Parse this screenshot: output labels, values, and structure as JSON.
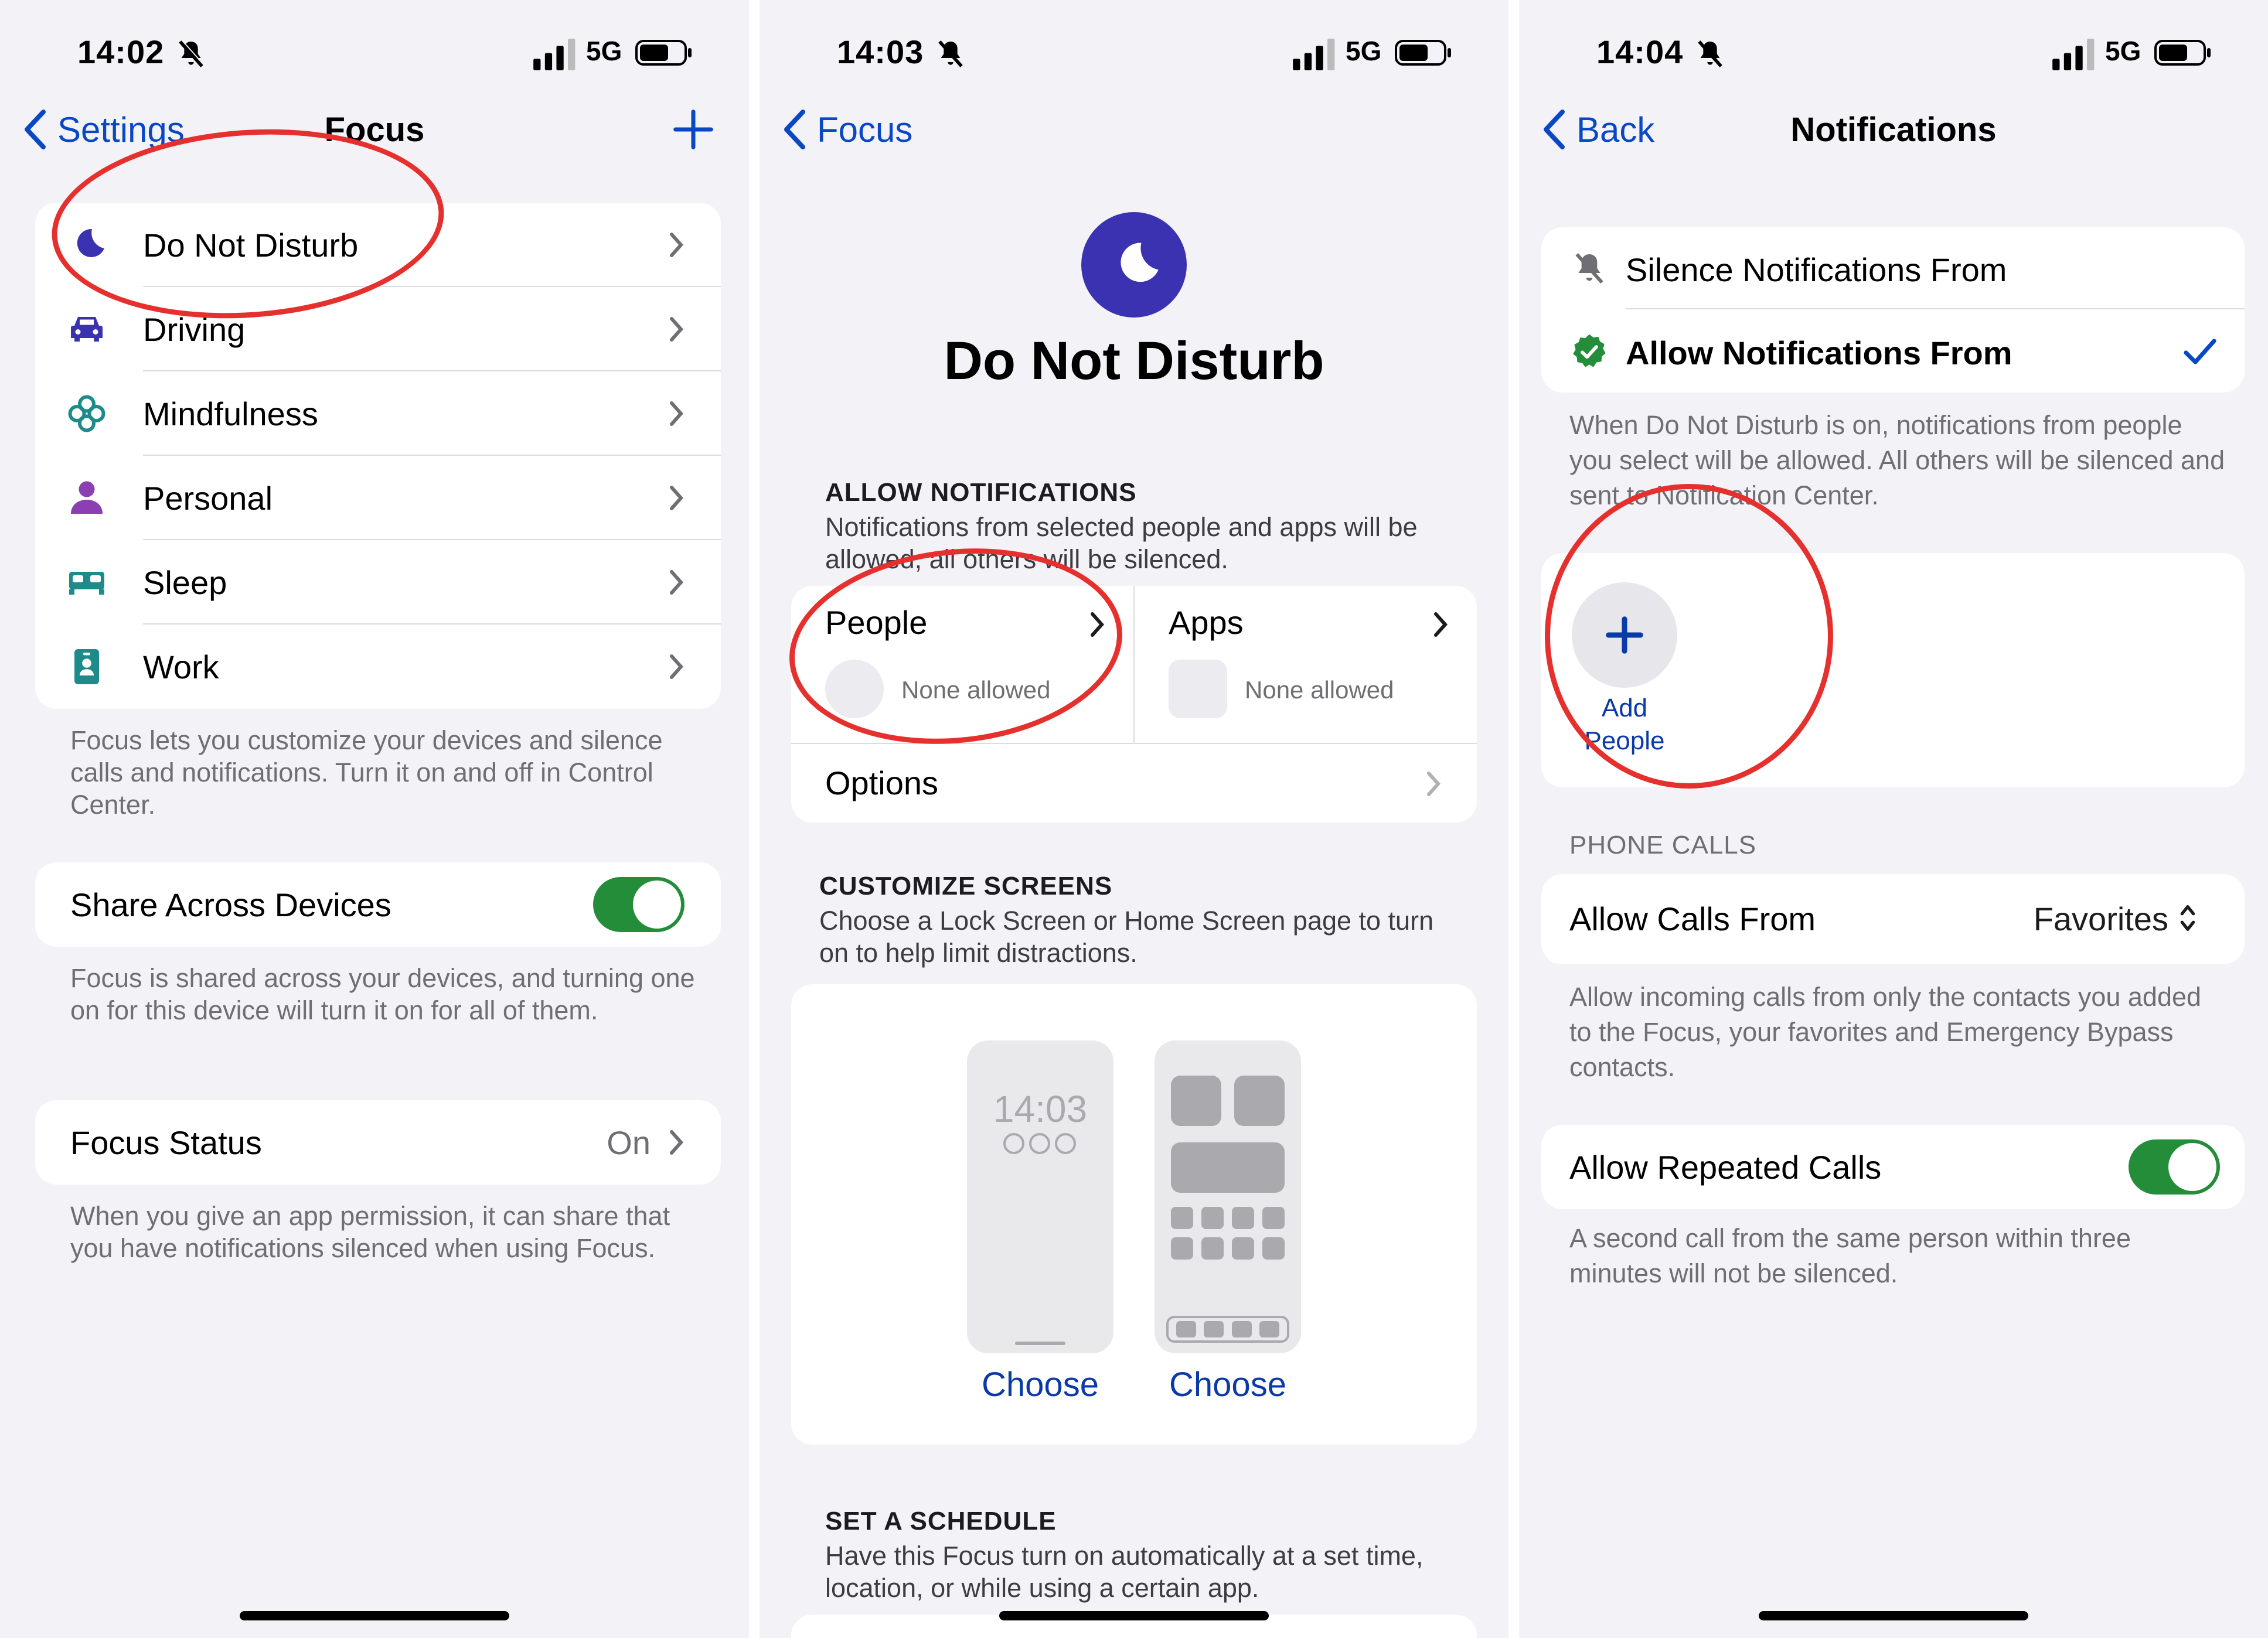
{
  "colors": {
    "accent": "#0a47c4",
    "toggle_on": "#238d3a",
    "annotation": "#e5302e",
    "dnd_purple": "#3a32b0"
  },
  "panel1": {
    "status": {
      "time": "14:02",
      "network": "5G"
    },
    "nav": {
      "back_label": "Settings",
      "title": "Focus"
    },
    "focus_list": [
      {
        "label": "Do Not Disturb",
        "icon": "moon-icon"
      },
      {
        "label": "Driving",
        "icon": "car-icon"
      },
      {
        "label": "Mindfulness",
        "icon": "flower-icon"
      },
      {
        "label": "Personal",
        "icon": "person-icon"
      },
      {
        "label": "Sleep",
        "icon": "bed-icon"
      },
      {
        "label": "Work",
        "icon": "badge-icon"
      }
    ],
    "focus_footer": "Focus lets you customize your devices and silence calls and notifications. Turn it on and off in Control Center.",
    "share_label": "Share Across Devices",
    "share_enabled": true,
    "share_footer": "Focus is shared across your devices, and turning one on for this device will turn it on for all of them.",
    "status_label": "Focus Status",
    "status_value": "On",
    "status_footer": "When you give an app permission, it can share that you have notifications silenced when using Focus."
  },
  "panel2": {
    "status": {
      "time": "14:03",
      "network": "5G"
    },
    "nav": {
      "back_label": "Focus"
    },
    "title": "Do Not Disturb",
    "allow_header": "ALLOW NOTIFICATIONS",
    "allow_sub": "Notifications from selected people and apps will be allowed, all others will be silenced.",
    "people_label": "People",
    "people_value": "None allowed",
    "apps_label": "Apps",
    "apps_value": "None allowed",
    "options_label": "Options",
    "customize_header": "CUSTOMIZE SCREENS",
    "customize_sub": "Choose a Lock Screen or Home Screen page to turn on to help limit distractions.",
    "lock_time": "14:03",
    "choose_lock": "Choose",
    "choose_home": "Choose",
    "schedule_header": "SET A SCHEDULE",
    "schedule_sub": "Have this Focus turn on automatically at a set time, location, or while using a certain app."
  },
  "panel3": {
    "status": {
      "time": "14:04",
      "network": "5G"
    },
    "nav": {
      "back_label": "Back",
      "title": "Notifications"
    },
    "silence_label": "Silence Notifications From",
    "allow_label": "Allow Notifications From",
    "allow_selected": true,
    "mode_footer": "When Do Not Disturb is on, notifications from people you select will be allowed. All others will be silenced and sent to Notification Center.",
    "add_people_line1": "Add",
    "add_people_line2": "People",
    "calls_header": "PHONE CALLS",
    "calls_label": "Allow Calls From",
    "calls_value": "Favorites",
    "calls_footer": "Allow incoming calls from only the contacts you added to the Focus, your favorites and Emergency Bypass contacts.",
    "repeat_label": "Allow Repeated Calls",
    "repeat_enabled": true,
    "repeat_footer": "A second call from the same person within three minutes will not be silenced."
  }
}
